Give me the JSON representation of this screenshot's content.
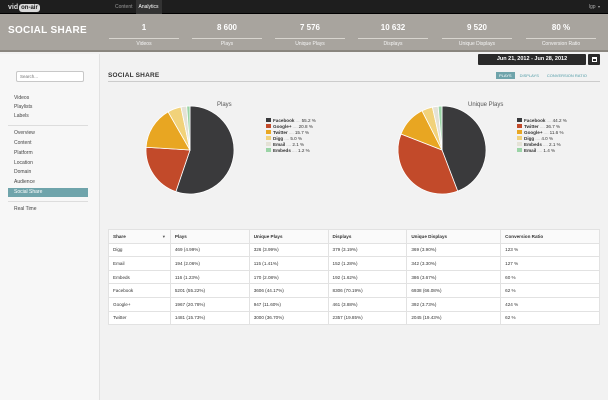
{
  "nav": {
    "logo_text": "vid",
    "logo_badge": "on-air",
    "links": [
      "Content",
      "Analytics"
    ],
    "user": "lgp"
  },
  "header": {
    "title": "SOCIAL SHARE",
    "stats": [
      {
        "value": "1",
        "label": "Videos"
      },
      {
        "value": "8 600",
        "label": "Plays"
      },
      {
        "value": "7 576",
        "label": "Unique Plays"
      },
      {
        "value": "10 632",
        "label": "Displays"
      },
      {
        "value": "9 520",
        "label": "Unique Displays"
      },
      {
        "value": "80 %",
        "label": "Conversion Ratio"
      }
    ]
  },
  "sidebar": {
    "search_placeholder": "Search...",
    "items": [
      "Videos",
      "Playlists",
      "Labels",
      "Overview",
      "Content",
      "Platform",
      "Location",
      "Domain",
      "Audience",
      "Social Share",
      "Real Time"
    ],
    "active": "Social Share"
  },
  "main": {
    "section_title": "SOCIAL SHARE",
    "date_range": "Jun 21, 2012 - Jun 28, 2012",
    "tabs": [
      "PLAYS",
      "DISPLAYS",
      "CONVERSION RATIO"
    ],
    "active_tab": "PLAYS"
  },
  "chart_data": [
    {
      "type": "pie",
      "title": "Plays",
      "slices": [
        {
          "name": "Facebook",
          "value": 55.2,
          "label": "55.2 %",
          "color": "#3a3a3c"
        },
        {
          "name": "Google+",
          "value": 20.8,
          "label": "20.8 %",
          "color": "#c24a2a"
        },
        {
          "name": "Twitter",
          "value": 15.7,
          "label": "15.7 %",
          "color": "#e8a622"
        },
        {
          "name": "Digg",
          "value": 5.0,
          "label": "5.0 %",
          "color": "#f1d27a"
        },
        {
          "name": "Email",
          "value": 2.1,
          "label": "2.1 %",
          "color": "#e4e2d6"
        },
        {
          "name": "Embeds",
          "value": 1.2,
          "label": "1.2 %",
          "color": "#9bd4a6"
        }
      ]
    },
    {
      "type": "pie",
      "title": "Unique Plays",
      "slices": [
        {
          "name": "Facebook",
          "value": 44.2,
          "label": "44.2 %",
          "color": "#3a3a3c"
        },
        {
          "name": "Twitter",
          "value": 36.7,
          "label": "36.7 %",
          "color": "#c24a2a"
        },
        {
          "name": "Google+",
          "value": 11.6,
          "label": "11.6 %",
          "color": "#e8a622"
        },
        {
          "name": "Digg",
          "value": 4.0,
          "label": "4.0 %",
          "color": "#f1d27a"
        },
        {
          "name": "Embeds",
          "value": 2.1,
          "label": "2.1 %",
          "color": "#e4e2d6"
        },
        {
          "name": "Email",
          "value": 1.4,
          "label": "1.4 %",
          "color": "#9bd4a6"
        }
      ]
    }
  ],
  "table": {
    "headers": [
      "Share",
      "Plays",
      "Unique Plays",
      "Displays",
      "Unique Displays",
      "Conversion Ratio"
    ],
    "rows": [
      [
        "Digg",
        "469 (4.99%)",
        "326 (3.99%)",
        "379 (3.19%)",
        "369 (3.90%)",
        "123 %"
      ],
      [
        "Email",
        "194 (2.06%)",
        "115 (1.41%)",
        "152 (1.28%)",
        "342 (3.30%)",
        "127 %"
      ],
      [
        "Embeds",
        "116 (1.23%)",
        "170 (2.08%)",
        "192 (1.62%)",
        "386 (3.67%)",
        "60 %"
      ],
      [
        "Facebook",
        "5201 (55.22%)",
        "3606 (44.17%)",
        "8306 (70.19%)",
        "6938 (66.08%)",
        "62 %"
      ],
      [
        "Google+",
        "1967 (20.78%)",
        "947 (11.60%)",
        "461 (3.88%)",
        "392 (3.73%)",
        "424 %"
      ],
      [
        "Twitter",
        "1481 (15.73%)",
        "3000 (36.70%)",
        "2357 (19.85%)",
        "2045 (19.43%)",
        "62 %"
      ]
    ]
  }
}
